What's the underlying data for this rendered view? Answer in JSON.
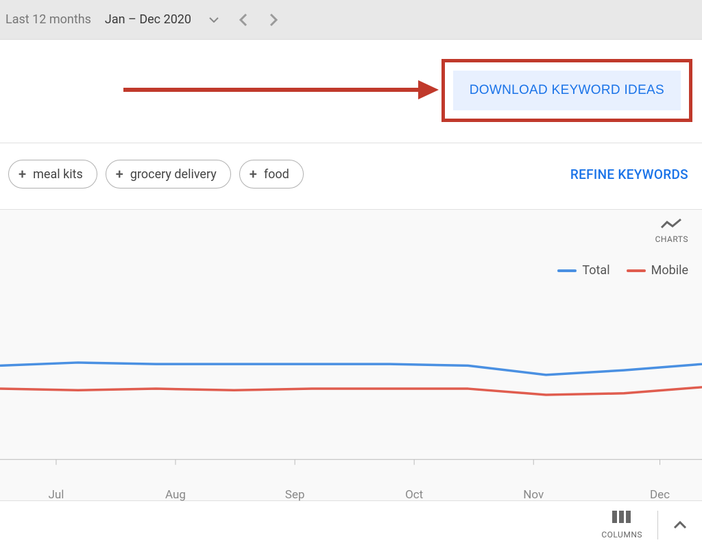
{
  "date": {
    "label": "Last 12 months",
    "range": "Jan – Dec 2020"
  },
  "download_label": "DOWNLOAD KEYWORD IDEAS",
  "chips": [
    "meal kits",
    "grocery delivery",
    "food"
  ],
  "refine_label": "REFINE KEYWORDS",
  "chart": {
    "charts_label": "CHARTS",
    "legend": {
      "total": "Total",
      "mobile": "Mobile"
    }
  },
  "columns_label": "COLUMNS",
  "colors": {
    "blue": "#4a90e2",
    "red": "#e05d4f",
    "callout": "#c0392b",
    "link": "#1a73e8"
  },
  "chart_data": {
    "type": "line",
    "x": [
      "Jul",
      "Aug",
      "Sep",
      "Oct",
      "Nov",
      "Dec"
    ],
    "title": "",
    "xlabel": "",
    "ylabel": "",
    "ylim": [
      0,
      100
    ],
    "series": [
      {
        "name": "Total",
        "color": "#4a90e2",
        "values": [
          61,
          63,
          62,
          62,
          62,
          62,
          61,
          55,
          58,
          62
        ]
      },
      {
        "name": "Mobile",
        "color": "#e05d4f",
        "values": [
          46,
          45,
          46,
          45,
          46,
          46,
          46,
          42,
          43,
          47
        ]
      }
    ],
    "x_positions_pct": [
      0,
      8,
      25,
      42,
      59,
      76,
      94,
      100
    ]
  }
}
